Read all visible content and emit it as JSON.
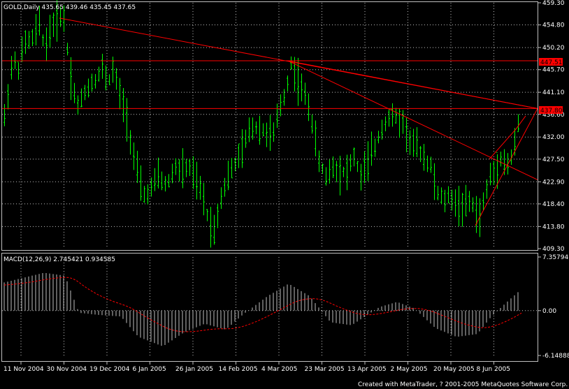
{
  "chart": {
    "header": "GOLD,Daily  435.65 439.46 435.45 437.65",
    "price_axis_labels": [
      "459.30",
      "454.80",
      "450.20",
      "445.70",
      "441.10",
      "436.60",
      "432.00",
      "427.50",
      "422.90",
      "418.40",
      "413.80",
      "409.30"
    ],
    "price_axis_range": [
      409.3,
      459.3
    ],
    "hline_labels": [
      "447.51",
      "437.80"
    ],
    "hline_values": [
      447.51,
      437.8
    ],
    "macd_header": "MACD(12,26,9)  2.745421  0.934585",
    "macd_axis_labels": [
      "7.35794",
      "0.00",
      "-6.14888"
    ],
    "macd_axis_range": [
      -6.14888,
      7.35794
    ],
    "date_labels": [
      "11 Nov 2004",
      "30 Nov 2004",
      "19 Dec 2004",
      "6 Jan 2005",
      "26 Jan 2005",
      "14 Feb 2005",
      "4 Mar 2005",
      "23 Mar 2005",
      "13 Apr 2005",
      "2 May 2005",
      "20 May 2005",
      "8 Jun 2005"
    ],
    "footer": "Created with MetaTrader, ? 2001-2005 MetaQuotes Software Corp.",
    "colors": {
      "background": "#000000",
      "grid": "#c0c0c0",
      "candle": "#00ff00",
      "macd_hist": "#c0c0c0",
      "signal": "#ff0000",
      "lines": "#ff0000",
      "text": "#ffffff"
    }
  }
}
